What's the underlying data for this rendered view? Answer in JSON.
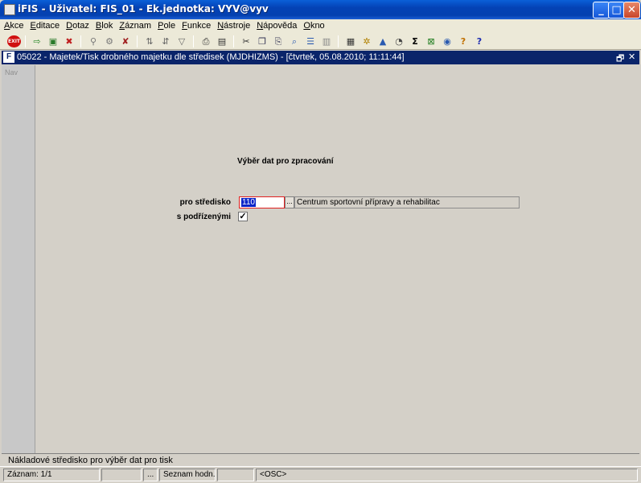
{
  "window": {
    "title": "iFIS - Uživatel: FIS_01 - Ek.jednotka: VYV@vyv",
    "minimize": "_",
    "maximize": "□",
    "close": "✕"
  },
  "menu": [
    "Akce",
    "Editace",
    "Dotaz",
    "Blok",
    "Záznam",
    "Pole",
    "Funkce",
    "Nástroje",
    "Nápověda",
    "Okno"
  ],
  "toolbar": {
    "exit_label": "EXIT",
    "icons": [
      "exit-icon",
      "save-icon",
      "print-icon",
      "delete-icon",
      "search-icon",
      "query-icon",
      "remove-icon",
      "sort-asc-icon",
      "sort-desc-icon",
      "filter-icon",
      "printer-icon",
      "preview-icon",
      "cut-icon",
      "copy-icon",
      "paste-icon",
      "find-icon",
      "list-icon",
      "columns-icon",
      "calculator-icon",
      "settings-icon",
      "chart-icon",
      "clock-icon",
      "sum-icon",
      "excel-icon",
      "web-icon",
      "help-icon",
      "context-help-icon"
    ]
  },
  "document": {
    "title": "05022 - Majetek/Tisk drobného majetku dle středisek (MJDHIZMS) - [čtvrtek, 05.08.2010; 11:11:44]",
    "restore": "🗗",
    "close": "✕",
    "nav_label": "Nav"
  },
  "form": {
    "heading": "Výběr dat pro zpracování",
    "stredisko_label": "pro středisko",
    "stredisko_value": "110",
    "stredisko_name": "Centrum sportovní přípravy a rehabilitac",
    "lov_label": "...",
    "podrizene_label": "s podřízenými",
    "podrizene_checked": "✓"
  },
  "status": {
    "hint": "Nákladové středisko pro výběr dat pro tisk",
    "record": "Záznam: 1/1",
    "cell2": "",
    "cell3": "...",
    "list": "Seznam hodn...",
    "cell5": "",
    "mode": "<OSC>"
  }
}
